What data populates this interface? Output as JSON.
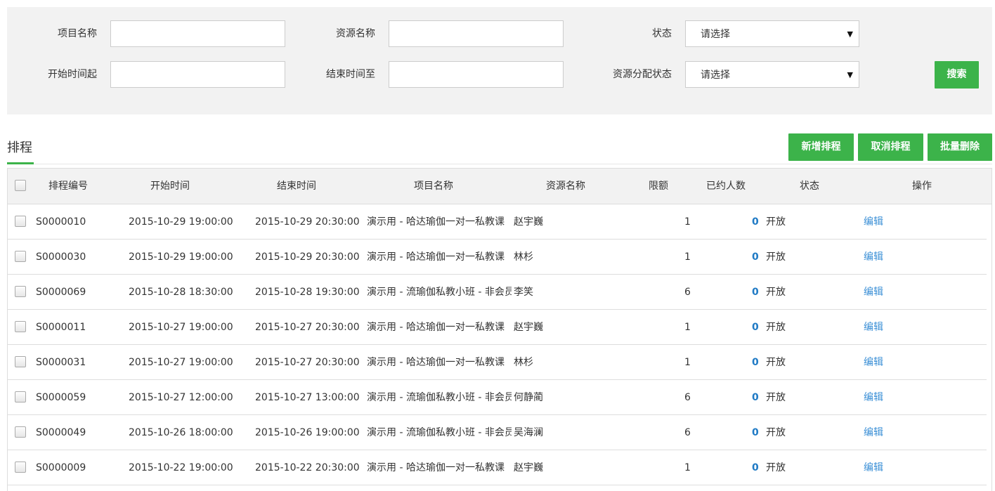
{
  "filters": {
    "project_name_label": "项目名称",
    "resource_name_label": "资源名称",
    "status_label": "状态",
    "status_value": "请选择",
    "start_time_label": "开始时间起",
    "end_time_label": "结束时间至",
    "alloc_status_label": "资源分配状态",
    "alloc_status_value": "请选择",
    "search_button": "搜索"
  },
  "section": {
    "title": "排程",
    "add_button": "新增排程",
    "cancel_button": "取消排程",
    "batch_delete_button": "批量删除"
  },
  "table": {
    "columns": {
      "id": "排程编号",
      "start": "开始时间",
      "end": "结束时间",
      "project": "项目名称",
      "resource": "资源名称",
      "quota": "限额",
      "booked": "已约人数",
      "status": "状态",
      "action": "操作"
    },
    "rows": [
      {
        "id": "S0000010",
        "start": "2015-10-29 19:00:00",
        "end": "2015-10-29 20:30:00",
        "project": "演示用 - 哈达瑜伽一对一私教课",
        "resource": "赵宇巍",
        "quota": "1",
        "booked": "0",
        "status": "开放",
        "action": "编辑"
      },
      {
        "id": "S0000030",
        "start": "2015-10-29 19:00:00",
        "end": "2015-10-29 20:30:00",
        "project": "演示用 - 哈达瑜伽一对一私教课",
        "resource": "林杉",
        "quota": "1",
        "booked": "0",
        "status": "开放",
        "action": "编辑"
      },
      {
        "id": "S0000069",
        "start": "2015-10-28 18:30:00",
        "end": "2015-10-28 19:30:00",
        "project": "演示用 - 流瑜伽私教小班 - 非会员",
        "resource": "李笑",
        "quota": "6",
        "booked": "0",
        "status": "开放",
        "action": "编辑"
      },
      {
        "id": "S0000011",
        "start": "2015-10-27 19:00:00",
        "end": "2015-10-27 20:30:00",
        "project": "演示用 - 哈达瑜伽一对一私教课",
        "resource": "赵宇巍",
        "quota": "1",
        "booked": "0",
        "status": "开放",
        "action": "编辑"
      },
      {
        "id": "S0000031",
        "start": "2015-10-27 19:00:00",
        "end": "2015-10-27 20:30:00",
        "project": "演示用 - 哈达瑜伽一对一私教课",
        "resource": "林杉",
        "quota": "1",
        "booked": "0",
        "status": "开放",
        "action": "编辑"
      },
      {
        "id": "S0000059",
        "start": "2015-10-27 12:00:00",
        "end": "2015-10-27 13:00:00",
        "project": "演示用 - 流瑜伽私教小班 - 非会员",
        "resource": "何静蔺",
        "quota": "6",
        "booked": "0",
        "status": "开放",
        "action": "编辑"
      },
      {
        "id": "S0000049",
        "start": "2015-10-26 18:00:00",
        "end": "2015-10-26 19:00:00",
        "project": "演示用 - 流瑜伽私教小班 - 非会员",
        "resource": "吴海澜",
        "quota": "6",
        "booked": "0",
        "status": "开放",
        "action": "编辑"
      },
      {
        "id": "S0000009",
        "start": "2015-10-22 19:00:00",
        "end": "2015-10-22 20:30:00",
        "project": "演示用 - 哈达瑜伽一对一私教课",
        "resource": "赵宇巍",
        "quota": "1",
        "booked": "0",
        "status": "开放",
        "action": "编辑"
      }
    ]
  }
}
